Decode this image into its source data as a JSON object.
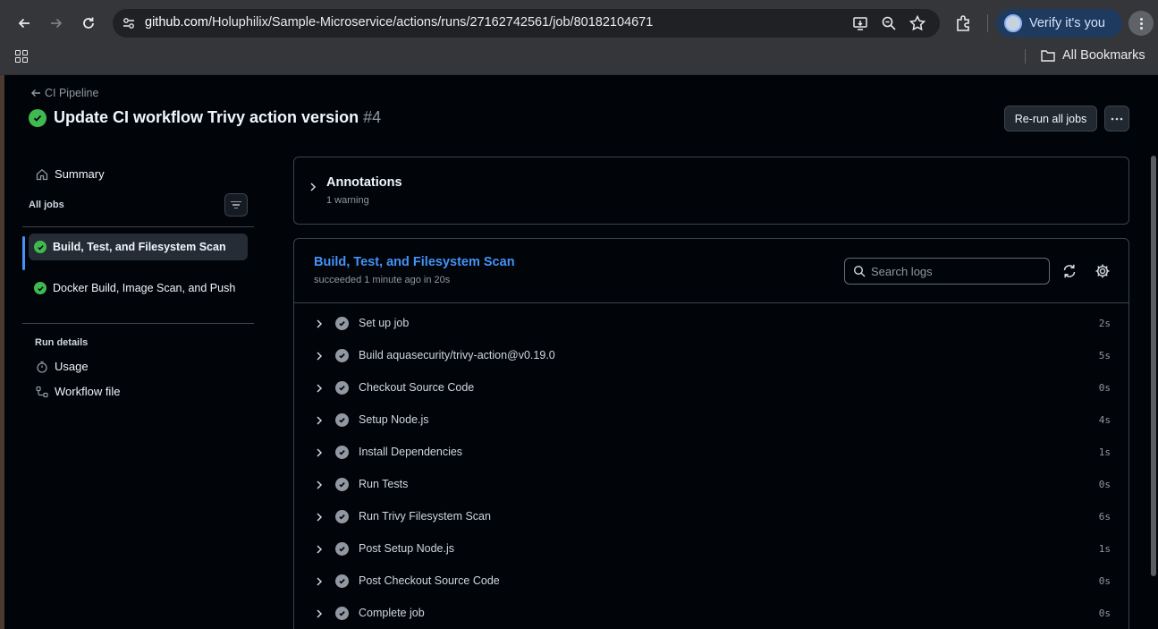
{
  "browser": {
    "url_host": "github.com",
    "url_path": "/Holuphilix/Sample-Microservice/actions/runs/27162742561/job/80182104671",
    "profile_label": "Verify it's you",
    "bookmarks_label": "All Bookmarks"
  },
  "page": {
    "back_link": "CI Pipeline",
    "title": "Update CI workflow Trivy action version",
    "run_number": "#4",
    "rerun_label": "Re-run all jobs"
  },
  "sidebar": {
    "summary_label": "Summary",
    "all_jobs_label": "All jobs",
    "jobs": [
      {
        "label": "Build, Test, and Filesystem Scan",
        "active": true
      },
      {
        "label": "Docker Build, Image Scan, and Push",
        "active": false
      }
    ],
    "run_details_label": "Run details",
    "usage_label": "Usage",
    "workflow_file_label": "Workflow file"
  },
  "annotations": {
    "title": "Annotations",
    "subtitle": "1 warning"
  },
  "job": {
    "title": "Build, Test, and Filesystem Scan",
    "subtitle": "succeeded 1 minute ago in 20s",
    "search_placeholder": "Search logs",
    "steps": [
      {
        "name": "Set up job",
        "time": "2s"
      },
      {
        "name": "Build aquasecurity/trivy-action@v0.19.0",
        "time": "5s"
      },
      {
        "name": "Checkout Source Code",
        "time": "0s"
      },
      {
        "name": "Setup Node.js",
        "time": "4s"
      },
      {
        "name": "Install Dependencies",
        "time": "1s"
      },
      {
        "name": "Run Tests",
        "time": "0s"
      },
      {
        "name": "Run Trivy Filesystem Scan",
        "time": "6s"
      },
      {
        "name": "Post Setup Node.js",
        "time": "1s"
      },
      {
        "name": "Post Checkout Source Code",
        "time": "0s"
      },
      {
        "name": "Complete job",
        "time": "0s"
      }
    ]
  },
  "colors": {
    "success": "#3fb950",
    "link": "#4493f8",
    "background": "#010409"
  }
}
